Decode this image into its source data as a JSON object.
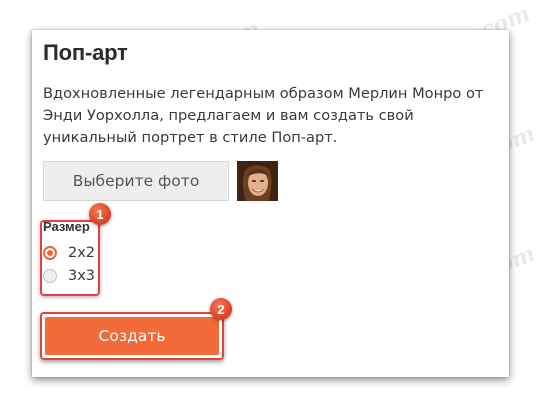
{
  "card": {
    "title": "Поп-арт",
    "description": "Вдохновленные легендарным образом Мерлин Монро от Энди Уорхолла, предлагаем и вам создать свой уникальный портрет в стиле Поп-арт."
  },
  "photo_picker": {
    "button_label": "Выберите фото",
    "thumbnail_icon": "woman-portrait-thumbnail"
  },
  "size": {
    "label": "Размер",
    "options": [
      {
        "label": "2x2",
        "selected": true
      },
      {
        "label": "3x3",
        "selected": false
      }
    ]
  },
  "create_button": {
    "label": "Создать"
  },
  "annotations": {
    "badge_1": "1",
    "badge_2": "2"
  },
  "watermark": "Soringpcrepair.com",
  "colors": {
    "accent": "#f26a3a",
    "highlight_frame": "#e2423f",
    "radio_selected": "#f4603a"
  }
}
